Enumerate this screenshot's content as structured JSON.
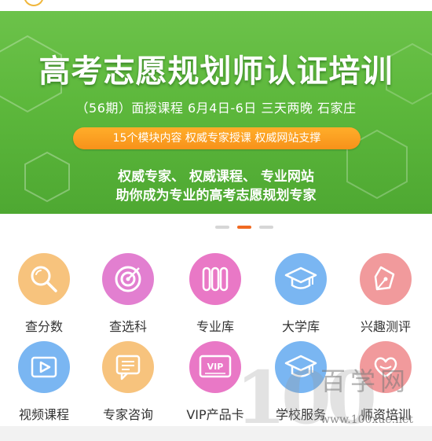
{
  "banner": {
    "title": "高考志愿规划师认证培训",
    "subtitle": "（56期）面授课程 6月4日-6日 三天两晚 石家庄",
    "pill": "15个模块内容   权威专家授课   权威网站支撑",
    "line1": "权威专家、 权威课程、 专业网站",
    "line2": "助你成为专业的高考志愿规划专家",
    "colors": {
      "green": "#5db83c",
      "orange": "#f7921a"
    }
  },
  "carousel": {
    "slide_count": 3,
    "active_index": 1
  },
  "menu": [
    {
      "label": "查分数",
      "icon": "magnifier-icon",
      "color": "#f7c37d"
    },
    {
      "label": "查选科",
      "icon": "target-icon",
      "color": "#e27fd0"
    },
    {
      "label": "专业库",
      "icon": "books-icon",
      "color": "#e978c6"
    },
    {
      "label": "大学库",
      "icon": "graduation-cap-icon",
      "color": "#7ab6f2"
    },
    {
      "label": "兴趣测评",
      "icon": "pen-nib-icon",
      "color": "#f19a9c"
    },
    {
      "label": "视频课程",
      "icon": "video-play-icon",
      "color": "#7ab6f2"
    },
    {
      "label": "专家咨询",
      "icon": "chat-bubble-icon",
      "color": "#f7c37d"
    },
    {
      "label": "VIP产品卡",
      "icon": "vip-card-icon",
      "color": "#e978c6",
      "icon_text": "VIP"
    },
    {
      "label": "学校服务",
      "icon": "graduation-cap-icon",
      "color": "#7ab6f2"
    },
    {
      "label": "师资培训",
      "icon": "heart-hands-icon",
      "color": "#f19a9c"
    }
  ],
  "watermark": {
    "number": "100",
    "text": "百学网",
    "url": "www.100xue.net"
  }
}
